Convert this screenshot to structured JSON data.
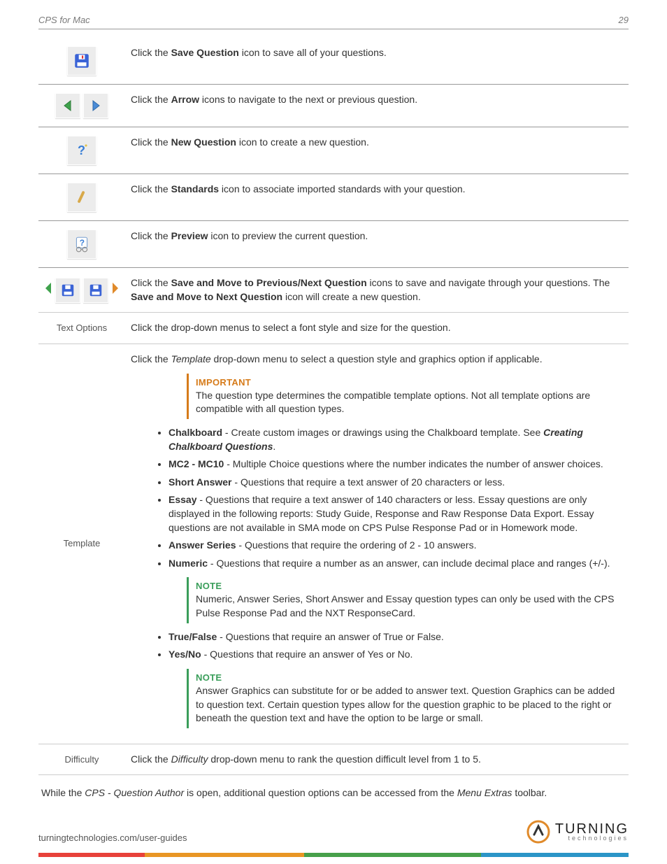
{
  "header": {
    "title": "CPS for Mac",
    "page": "29"
  },
  "rows": [
    {
      "id": "save",
      "text_pre": "Click the ",
      "term": "Save Question",
      "text_post": " icon to save all of your questions."
    },
    {
      "id": "arrows",
      "text_pre": "Click the ",
      "term": "Arrow",
      "text_post": " icons to navigate to the next or previous question."
    },
    {
      "id": "newq",
      "text_pre": "Click the ",
      "term": "New Question",
      "text_post": " icon to create a new question."
    },
    {
      "id": "std",
      "text_pre": "Click the ",
      "term": "Standards",
      "text_post": " icon to associate imported standards with your question."
    },
    {
      "id": "prev",
      "text_pre": "Click the ",
      "term": "Preview",
      "text_post": " icon to preview the current question."
    }
  ],
  "savemove": {
    "text1_pre": "Click the ",
    "term1": "Save and Move to Previous/Next Question",
    "text1_post": " icons to save and navigate through your questions. The ",
    "term2": "Save and Move to Next Question",
    "text2_post": " icon will create a new question."
  },
  "textopts": {
    "label": "Text Options",
    "text": "Click the drop-down menus to select a font style and size for the question."
  },
  "template": {
    "label": "Template",
    "intro_pre": "Click the ",
    "intro_term": "Template",
    "intro_post": " drop-down menu to select a question style and graphics option if applicable.",
    "important_title": "IMPORTANT",
    "important_body": "The question type determines the compatible template options. Not all template options are compatible with all question types.",
    "items": [
      {
        "name": "Chalkboard",
        "desc": " - Create custom images or drawings using the Chalkboard template. See ",
        "link": "Creating Chalkboard Questions",
        "tail": "."
      },
      {
        "name": "MC2 - MC10",
        "desc": " - Multiple Choice questions where the number indicates the number of answer choices."
      },
      {
        "name": "Short Answer",
        "desc": " - Questions that require a text answer of 20 characters or less."
      },
      {
        "name": "Essay",
        "desc": " - Questions that require a text answer of 140 characters or less. Essay questions are only displayed in the following reports: Study Guide, Response and Raw Response Data Export. Essay questions are not available in SMA mode on CPS Pulse Response Pad or in Homework mode."
      },
      {
        "name": "Answer Series",
        "desc": " - Questions that require the ordering of 2 - 10 answers."
      },
      {
        "name": "Numeric",
        "desc": " - Questions that require a number as an answer, can include decimal place and ranges (+/-)."
      }
    ],
    "note1_title": "NOTE",
    "note1_body": "Numeric, Answer Series, Short Answer and Essay question types can only be used with the CPS Pulse Response Pad and the NXT ResponseCard.",
    "items2": [
      {
        "name": "True/False",
        "desc": " - Questions that require an answer of True or False."
      },
      {
        "name": "Yes/No",
        "desc": " - Questions that require an answer of Yes or No."
      }
    ],
    "note2_title": "NOTE",
    "note2_body": "Answer Graphics can substitute for or be added to answer text. Question Graphics can be added to question text. Certain question types allow for the question graphic to be placed to the right or beneath the question text and have the option to be large or small."
  },
  "difficulty": {
    "label": "Difficulty",
    "text_pre": "Click the ",
    "term": "Difficulty",
    "text_post": " drop-down menu to rank the question difficult level from 1 to 5."
  },
  "closing": {
    "pre": "While the ",
    "term1": "CPS - Question Author",
    "mid": " is open, additional question options can be accessed from the ",
    "term2": "Menu Extras",
    "post": " toolbar."
  },
  "footer": {
    "url": "turningtechnologies.com/user-guides",
    "brand_main": "TURNING",
    "brand_sub": "technologies"
  }
}
